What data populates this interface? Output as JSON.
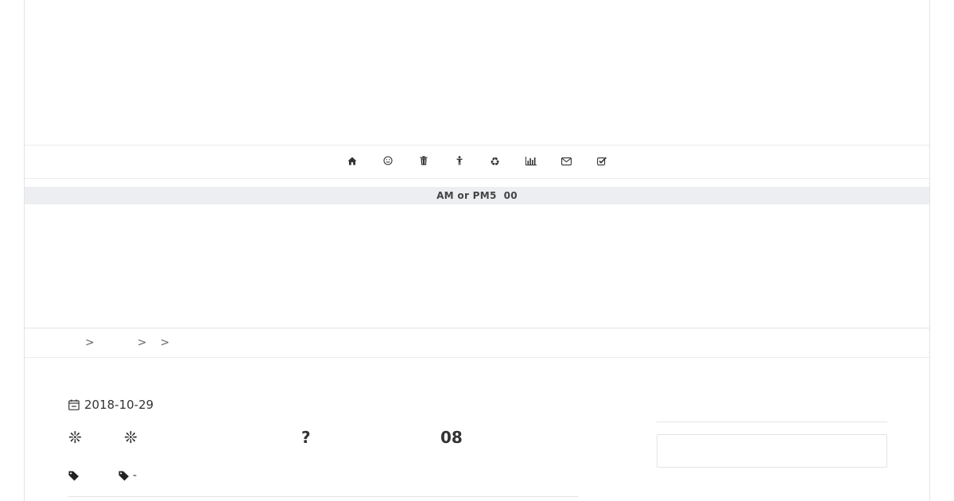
{
  "nav": {
    "items": [
      {
        "icon": "home-icon",
        "glyph": "🏠"
      },
      {
        "icon": "smile-icon",
        "glyph": "☺"
      },
      {
        "icon": "trash-icon",
        "glyph": "🗑"
      },
      {
        "icon": "person-icon",
        "glyph": "🚹"
      },
      {
        "icon": "recycle-icon",
        "glyph": "♻"
      },
      {
        "icon": "bar-chart-icon",
        "glyph": "📊"
      },
      {
        "icon": "envelope-icon",
        "glyph": "✉"
      },
      {
        "icon": "check-square-icon",
        "glyph": "☑"
      }
    ]
  },
  "notice": {
    "text": "AM or PM5  00"
  },
  "breadcrumb": {
    "links": [
      "",
      "",
      ""
    ],
    "separator": ">"
  },
  "article": {
    "date": "2018-10-29",
    "title_parts": [
      "❊",
      "❊",
      "?",
      "08"
    ],
    "tags": [
      "",
      "-"
    ]
  }
}
